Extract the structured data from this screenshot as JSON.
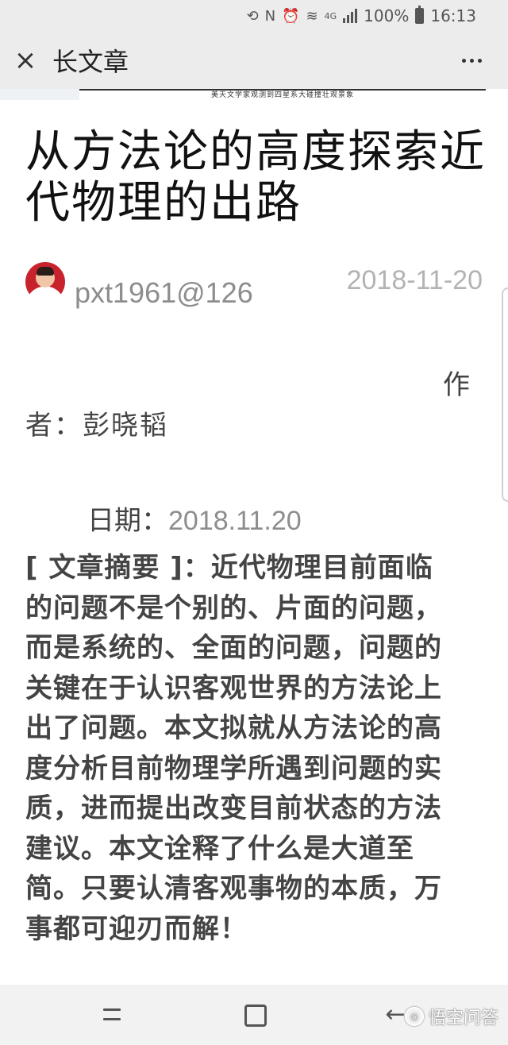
{
  "status_bar": {
    "icons": [
      "sync-icon",
      "nfc-icon",
      "alarm-icon",
      "wifi-icon",
      "4g-icon",
      "signal-icon",
      "battery-icon"
    ],
    "network_label": "4G",
    "battery_label": "100%",
    "time": "16:13"
  },
  "app_bar": {
    "close_label": "×",
    "title": "长文章",
    "more_icon": "more-vertical-icon"
  },
  "article": {
    "banner_text": "美天文学家观测到四星系大碰撞壮观景象",
    "title": "从方法论的高度探索近代物理的出路",
    "author_handle": "pxt1961@126",
    "post_date": "2018-11-20",
    "author_line_1": "作",
    "author_line_2": "者：彭晓韬",
    "date_label": "日期：",
    "date_value": "2018.11.20",
    "abstract_lines": [
      "[ 文章摘要 ]：近代物理目前面临",
      "的问题不是个别的、片面的问题，",
      "而是系统的、全面的问题，问题的",
      "关键在于认识客观世界的方法论上",
      "出了问题。本文拟就从方法论的高",
      "度分析目前物理学所遇到问题的实",
      "质，进而提出改变目前状态的方法",
      "建议。本文诠释了什么是大道至",
      "简。只要认清客观事物的本质，万",
      "事都可迎刃而解！"
    ]
  },
  "nav_bar": {
    "back_label": "←",
    "watermark": "悟空问答"
  }
}
